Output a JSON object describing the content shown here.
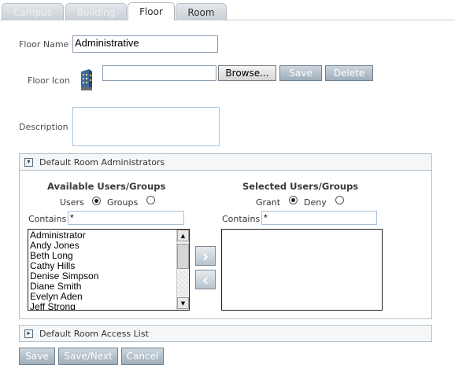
{
  "tabs": [
    {
      "label": "Campus",
      "active": false
    },
    {
      "label": "Building",
      "active": false
    },
    {
      "label": "Floor",
      "active": true
    },
    {
      "label": "Room",
      "active": false
    }
  ],
  "floor_name": {
    "label": "Floor Name",
    "value": "Administrative"
  },
  "floor_icon": {
    "label": "Floor Icon",
    "file_value": "",
    "browse_label": "Browse...",
    "save_label": "Save",
    "delete_label": "Delete",
    "icon": "building-icon"
  },
  "description": {
    "label": "Description",
    "value": ""
  },
  "admins_section": {
    "title": "Default Room Administrators",
    "available": {
      "title": "Available Users/Groups",
      "option_users": "Users",
      "option_groups": "Groups",
      "selected_option": "Users",
      "contains_label": "Contains",
      "contains_value": "*",
      "items": [
        "Administrator",
        "Andy Jones",
        "Beth Long",
        "Cathy Hills",
        "Denise Simpson",
        "Diane Smith",
        "Evelyn Aden",
        "Jeff Strong"
      ]
    },
    "selected": {
      "title": "Selected Users/Groups",
      "option_grant": "Grant",
      "option_deny": "Deny",
      "selected_option": "Grant",
      "contains_label": "Contains",
      "contains_value": "*",
      "items": []
    },
    "move_right": "›",
    "move_left": "‹"
  },
  "access_section": {
    "title": "Default Room Access List"
  },
  "footer": {
    "save_label": "Save",
    "save_next_label": "Save/Next",
    "cancel_label": "Cancel"
  },
  "colors": {
    "button_fill": "#a9b8c4",
    "border": "#b0bfcc"
  }
}
